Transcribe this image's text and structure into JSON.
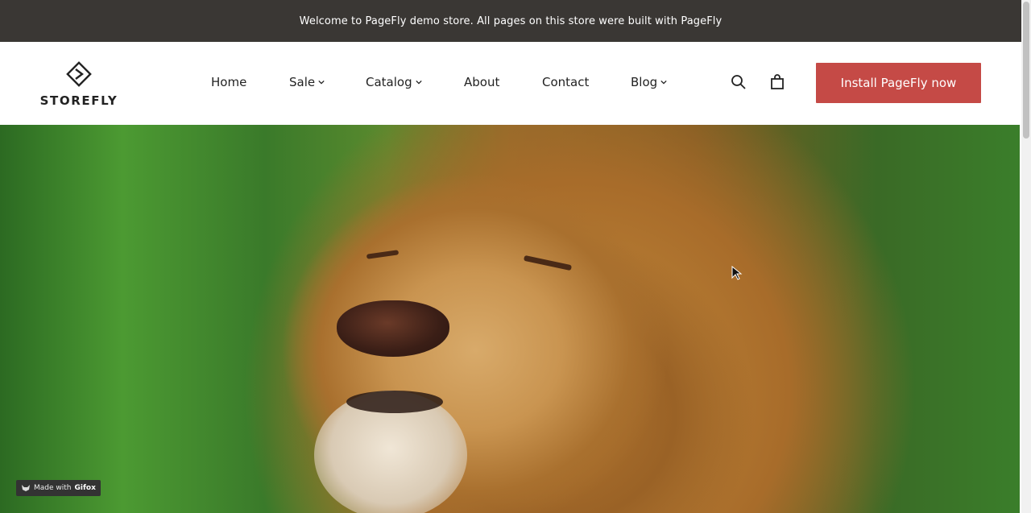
{
  "announcement": {
    "text": "Welcome to PageFly demo store. All pages on this store were built with PageFly"
  },
  "logo": {
    "text": "STOREFLY",
    "icon": "storefly-logo-icon"
  },
  "nav": {
    "items": [
      {
        "label": "Home",
        "dropdown": false
      },
      {
        "label": "Sale",
        "dropdown": true
      },
      {
        "label": "Catalog",
        "dropdown": true
      },
      {
        "label": "About",
        "dropdown": false
      },
      {
        "label": "Contact",
        "dropdown": false
      },
      {
        "label": "Blog",
        "dropdown": true
      }
    ],
    "search_icon": "search-icon",
    "cart_icon": "cart-icon"
  },
  "cta": {
    "label": "Install PageFly now",
    "color": "#c54a46"
  },
  "hero": {
    "image": "lion-face-photo"
  },
  "gifox": {
    "prefix": "Made with",
    "brand": "Gifox"
  },
  "colors": {
    "announcement_bg": "#3a3734",
    "accent": "#c54a46"
  }
}
